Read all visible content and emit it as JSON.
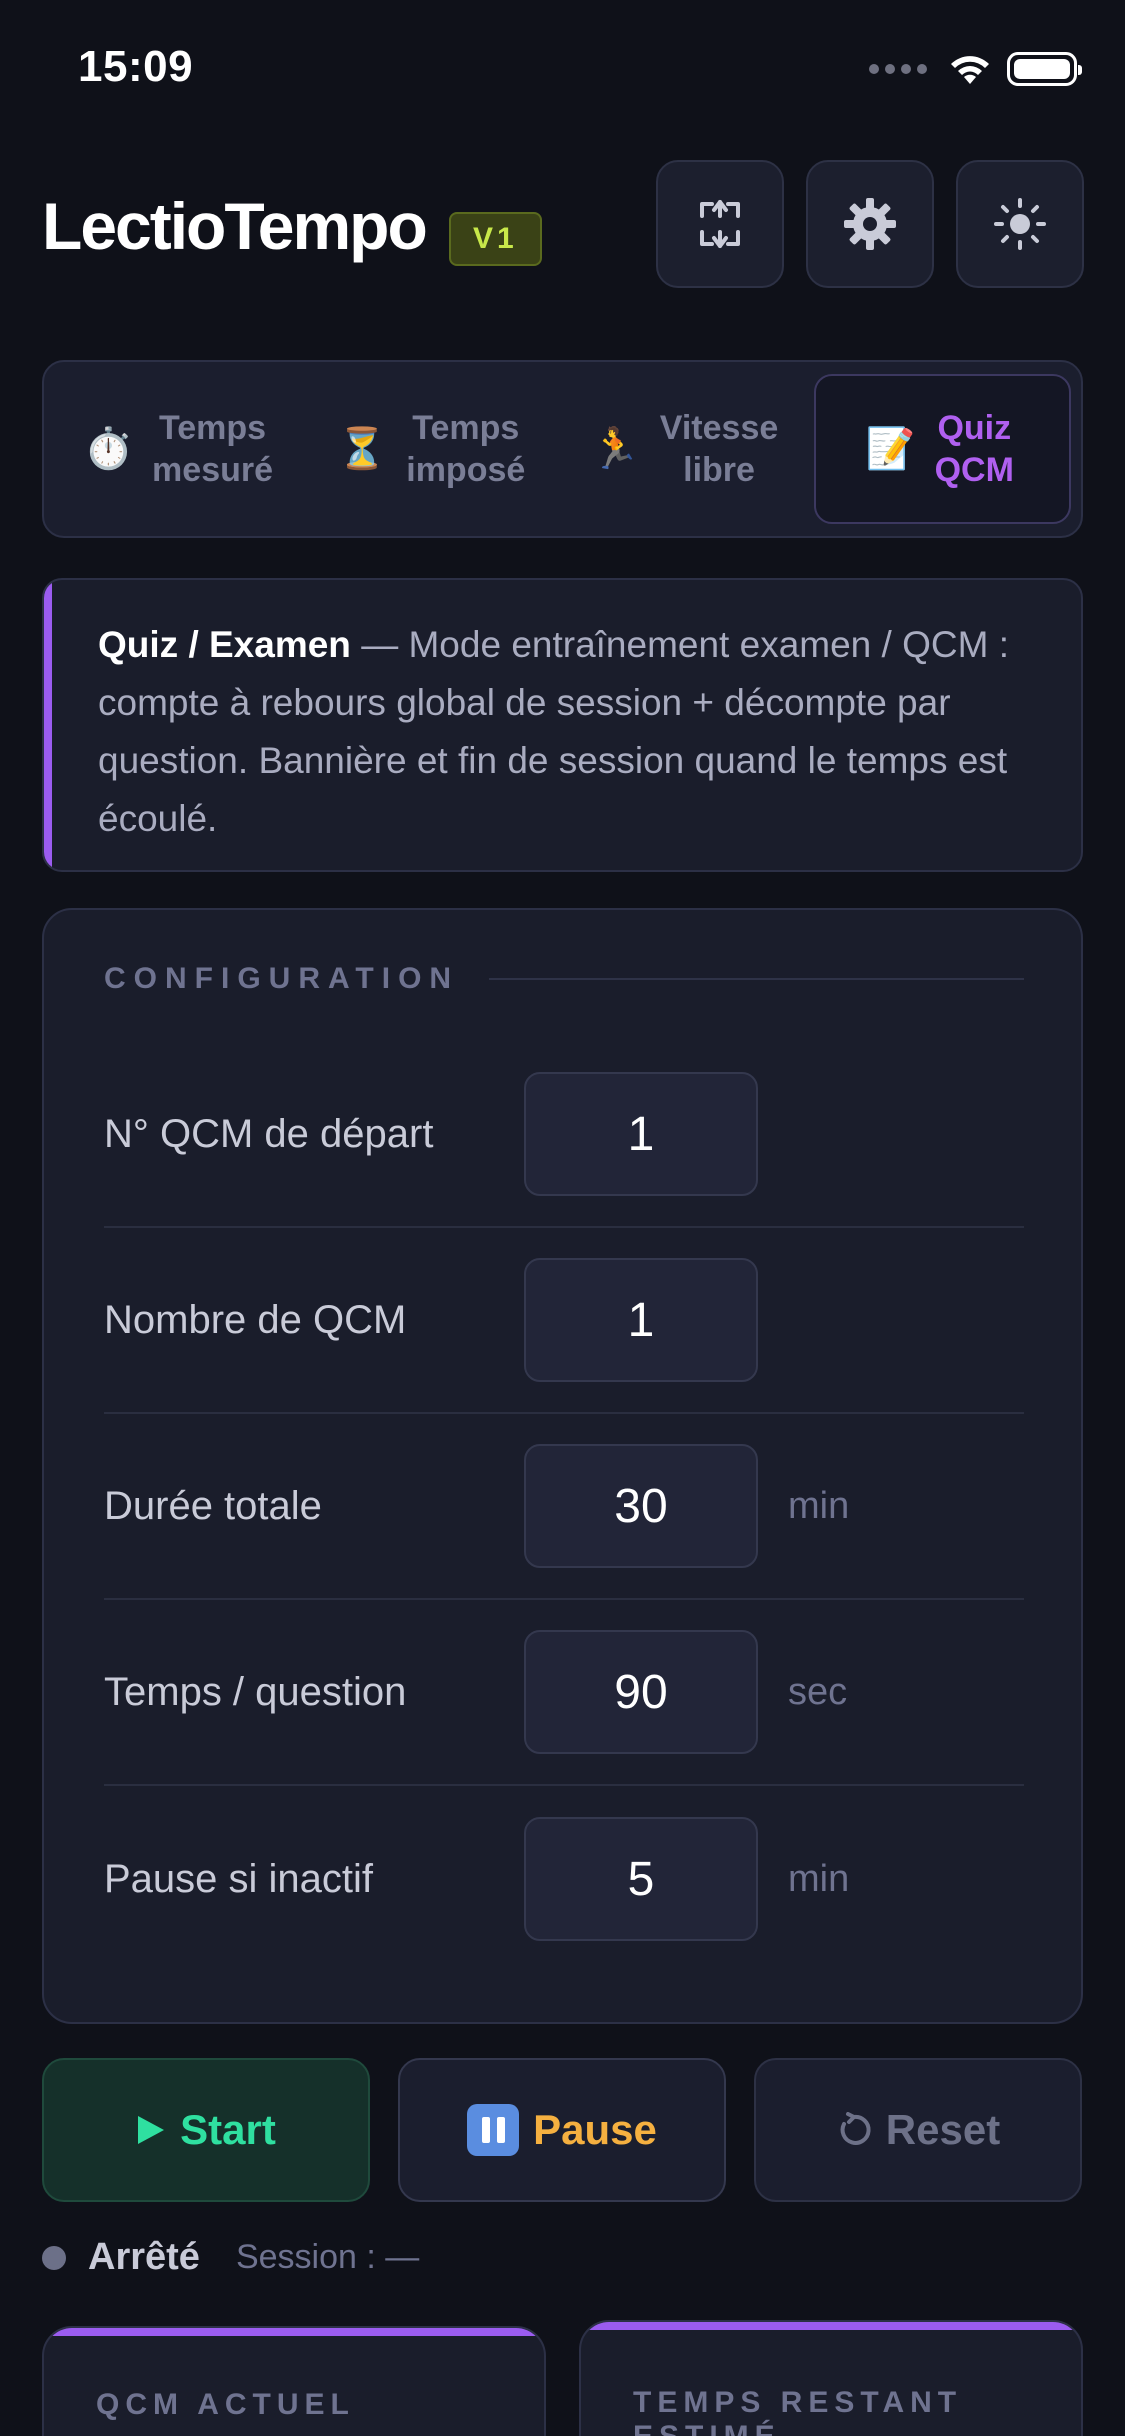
{
  "status_bar": {
    "time": "15:09"
  },
  "header": {
    "title": "LectioTempo",
    "version": "V1"
  },
  "tabs": [
    {
      "icon": "⏱️",
      "label": "Temps mesuré",
      "active": false
    },
    {
      "icon": "⏳",
      "label": "Temps imposé",
      "active": false
    },
    {
      "icon": "🏃",
      "label": "Vitesse libre",
      "active": false
    },
    {
      "icon": "📝",
      "label": "Quiz QCM",
      "active": true
    }
  ],
  "info": {
    "title": "Quiz / Examen",
    "text": " — Mode entraînement examen / QCM : compte à rebours global de session + décompte par question. Bannière et fin de session quand le temps est écoulé."
  },
  "config": {
    "title": "CONFIGURATION",
    "rows": [
      {
        "label": "N° QCM de départ",
        "value": "1",
        "unit": ""
      },
      {
        "label": "Nombre de QCM",
        "value": "1",
        "unit": ""
      },
      {
        "label": "Durée totale",
        "value": "30",
        "unit": "min"
      },
      {
        "label": "Temps / question",
        "value": "90",
        "unit": "sec"
      },
      {
        "label": "Pause si inactif",
        "value": "5",
        "unit": "min"
      }
    ]
  },
  "actions": {
    "start": "Start",
    "pause": "Pause",
    "reset": "Reset"
  },
  "status": {
    "state": "Arrêté",
    "session": "Session : —"
  },
  "cards": {
    "current_label": "QCM ACTUEL",
    "remaining_label": "TEMPS RESTANT ESTIMÉ"
  },
  "colors": {
    "accent": "#9b5cf0",
    "start": "#2fe0a0",
    "pause": "#f5b040",
    "version": "#c8e84a"
  }
}
